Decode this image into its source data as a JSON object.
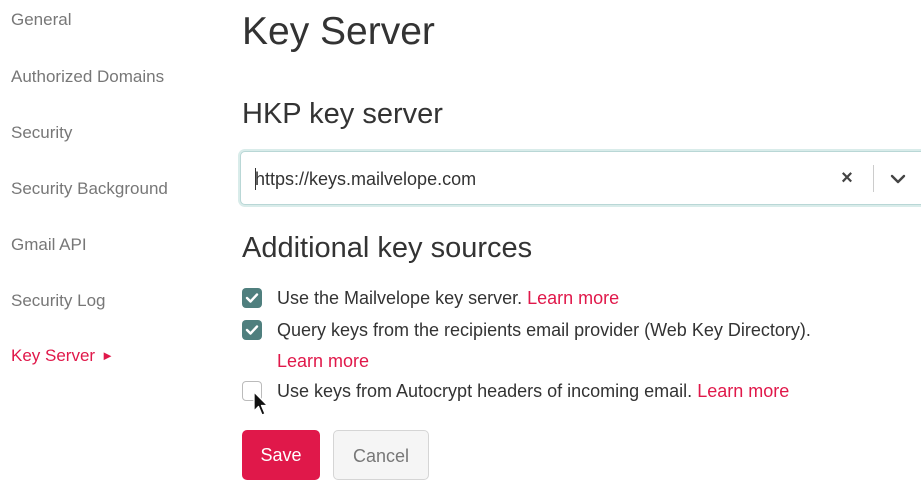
{
  "sidebar": {
    "items": [
      {
        "label": "General"
      },
      {
        "label": "Authorized Domains"
      },
      {
        "label": "Security"
      },
      {
        "label": "Security Background"
      },
      {
        "label": "Gmail API"
      },
      {
        "label": "Security Log"
      },
      {
        "label": "Key Server",
        "arrow": "►",
        "active": true
      }
    ]
  },
  "main": {
    "title": "Key Server",
    "hkp": {
      "heading": "HKP key server",
      "value": "https://keys.mailvelope.com",
      "clear_glyph": "×",
      "toggle_icon": "chevron-down-icon"
    },
    "additional": {
      "heading": "Additional key sources",
      "options": [
        {
          "text": "Use the Mailvelope key server.",
          "link": "Learn more",
          "checked": true
        },
        {
          "text": "Query keys from the recipients email provider (Web Key Directory).",
          "link": "Learn more",
          "checked": true
        },
        {
          "text": "Use keys from Autocrypt headers of incoming email.",
          "link": "Learn more",
          "checked": false
        }
      ]
    },
    "buttons": {
      "save": "Save",
      "cancel": "Cancel"
    }
  },
  "colors": {
    "accent": "#e0184a",
    "checkbox": "#4f7f7e",
    "focus_border": "#b9d7d6"
  }
}
